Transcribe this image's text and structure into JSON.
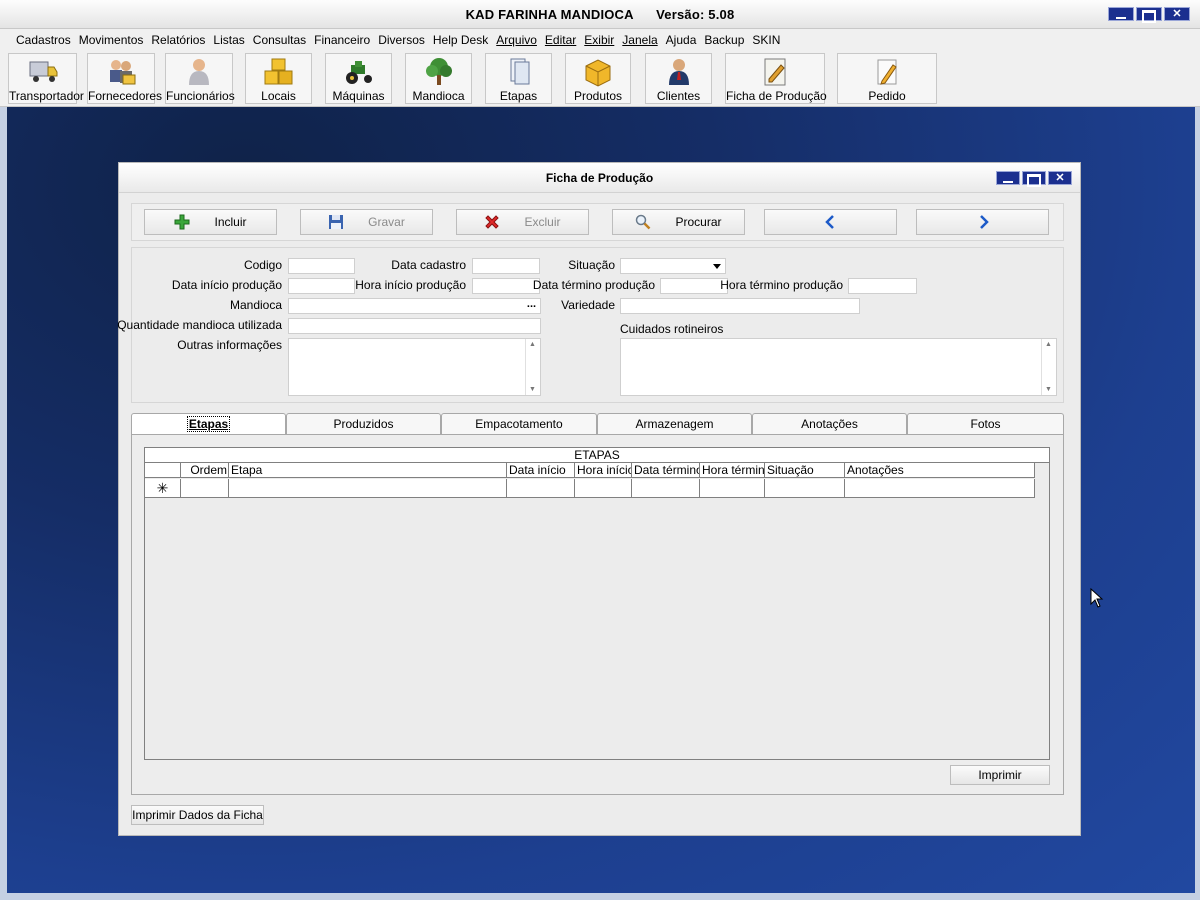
{
  "app": {
    "title": "KAD FARINHA MANDIOCA      Versão: 5.08"
  },
  "menu": [
    {
      "label": "Cadastros"
    },
    {
      "label": "Movimentos"
    },
    {
      "label": "Relatórios"
    },
    {
      "label": "Listas"
    },
    {
      "label": "Consultas"
    },
    {
      "label": "Financeiro"
    },
    {
      "label": "Diversos"
    },
    {
      "label": "Help Desk"
    },
    {
      "label": "Arquivo"
    },
    {
      "label": "Editar"
    },
    {
      "label": "Exibir"
    },
    {
      "label": "Janela"
    },
    {
      "label": "Ajuda"
    },
    {
      "label": "Backup"
    },
    {
      "label": "SKIN"
    }
  ],
  "toolbar": [
    {
      "label": "Transportador",
      "icon": "truck-icon"
    },
    {
      "label": "Fornecedores",
      "icon": "suppliers-icon"
    },
    {
      "label": "Funcionários",
      "icon": "employee-icon"
    },
    {
      "label": "Locais",
      "icon": "boxes-icon"
    },
    {
      "label": "Máquinas",
      "icon": "tractor-icon"
    },
    {
      "label": "Mandioca",
      "icon": "tree-icon"
    },
    {
      "label": "Etapas",
      "icon": "pages-icon"
    },
    {
      "label": "Produtos",
      "icon": "package-icon"
    },
    {
      "label": "Clientes",
      "icon": "client-icon"
    },
    {
      "label": "Ficha de Produção",
      "icon": "notebook-icon"
    },
    {
      "label": "Pedido",
      "icon": "pencil-icon"
    }
  ],
  "window": {
    "title": "Ficha de Produção",
    "nav": {
      "incluir": "Incluir",
      "gravar": "Gravar",
      "excluir": "Excluir",
      "procurar": "Procurar"
    },
    "form": {
      "codigo": {
        "label": "Codigo",
        "value": ""
      },
      "data_cadastro": {
        "label": "Data cadastro",
        "value": ""
      },
      "situacao": {
        "label": "Situação",
        "value": ""
      },
      "data_inicio": {
        "label": "Data início produção",
        "value": ""
      },
      "hora_inicio": {
        "label": "Hora início produção",
        "value": ""
      },
      "data_termino": {
        "label": "Data término produção",
        "value": ""
      },
      "hora_termino": {
        "label": "Hora término produção",
        "value": ""
      },
      "mandioca": {
        "label": "Mandioca",
        "value": ""
      },
      "variedade": {
        "label": "Variedade",
        "value": ""
      },
      "quantidade": {
        "label": "Quantidade mandioca utilizada",
        "value": ""
      },
      "outras": {
        "label": "Outras informações",
        "value": ""
      },
      "cuidados": {
        "label": "Cuidados rotineiros",
        "value": ""
      }
    },
    "tabs": [
      {
        "label": "Etapas",
        "active": true
      },
      {
        "label": "Produzidos",
        "active": false
      },
      {
        "label": "Empacotamento",
        "active": false
      },
      {
        "label": "Armazenagem",
        "active": false
      },
      {
        "label": "Anotações",
        "active": false
      },
      {
        "label": "Fotos",
        "active": false
      }
    ],
    "grid": {
      "caption": "ETAPAS",
      "columns": [
        "Ordem",
        "Etapa",
        "Data início",
        "Hora início",
        "Data término",
        "Hora término",
        "Situação",
        "Anotações"
      ],
      "new_row_marker": "✳"
    },
    "print_button": "Imprimir",
    "print_ficha_button": "Imprimir Dados da Ficha"
  }
}
